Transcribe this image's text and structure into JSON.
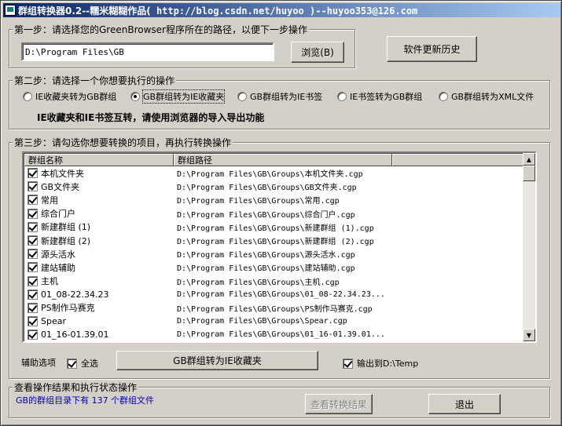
{
  "window": {
    "title_prefix": "群组转换器0.2--糯米糊糊作品(",
    "title_url": " http://blog.csdn.net/huyoo ",
    "title_suffix": ")--huyoo353@126.com"
  },
  "step1": {
    "legend": "第一步：请选择您的GreenBrowser程序所在的路径，以便下一步操作",
    "path_value": "D:\\Program Files\\GB",
    "browse_label": "浏览(B)",
    "history_label": "软件更新历史"
  },
  "step2": {
    "legend": "第二步：请选择一个你想要执行的操作",
    "options": [
      {
        "label": "IE收藏夹转为GB群组",
        "selected": false
      },
      {
        "label": "GB群组转为IE收藏夹",
        "selected": true
      },
      {
        "label": "GB群组转为IE书签",
        "selected": false
      },
      {
        "label": "IE书签转为GB群组",
        "selected": false
      },
      {
        "label": "GB群组转为XML文件",
        "selected": false
      }
    ],
    "note": "IE收藏夹和IE书签互转，请使用浏览器的导入导出功能"
  },
  "step3": {
    "legend": "第三步：请勾选你想要转换的项目，再执行转换操作",
    "columns": [
      "群组名称",
      "群组路径"
    ],
    "rows": [
      {
        "name": "本机文件夹",
        "path": "D:\\Program Files\\GB\\Groups\\本机文件夹.cgp",
        "checked": true
      },
      {
        "name": "GB文件夹",
        "path": "D:\\Program Files\\GB\\Groups\\GB文件夹.cgp",
        "checked": true
      },
      {
        "name": "常用",
        "path": "D:\\Program Files\\GB\\Groups\\常用.cgp",
        "checked": true
      },
      {
        "name": "综合门户",
        "path": "D:\\Program Files\\GB\\Groups\\综合门户.cgp",
        "checked": true
      },
      {
        "name": "新建群组 (1)",
        "path": "D:\\Program Files\\GB\\Groups\\新建群组 (1).cgp",
        "checked": true
      },
      {
        "name": "新建群组 (2)",
        "path": "D:\\Program Files\\GB\\Groups\\新建群组 (2).cgp",
        "checked": true
      },
      {
        "name": "源头活水",
        "path": "D:\\Program Files\\GB\\Groups\\源头活水.cgp",
        "checked": true
      },
      {
        "name": "建站辅助",
        "path": "D:\\Program Files\\GB\\Groups\\建站辅助.cgp",
        "checked": true
      },
      {
        "name": "主机",
        "path": "D:\\Program Files\\GB\\Groups\\主机.cgp",
        "checked": true
      },
      {
        "name": "01_08-22.34.23",
        "path": "D:\\Program Files\\GB\\Groups\\01_08-22.34.23...",
        "checked": true
      },
      {
        "name": "PS制作马赛克",
        "path": "D:\\Program Files\\GB\\Groups\\PS制作马赛克.cgp",
        "checked": true
      },
      {
        "name": "Spear",
        "path": "D:\\Program Files\\GB\\Groups\\Spear.cgp",
        "checked": true
      },
      {
        "name": "01_16-01.39.01",
        "path": "D:\\Program Files\\GB\\Groups\\01_16-01.39.01...",
        "checked": true
      }
    ],
    "aux_label": "辅助选项",
    "select_all_label": "全选",
    "select_all_checked": true,
    "convert_label": "GB群组转为IE收藏夹",
    "output_label": "输出到D:\\Temp",
    "output_checked": true
  },
  "status": {
    "legend": "查看操作结果和执行状态操作",
    "message": "GB的群组目录下有 137 个群组文件",
    "view_result_label": "查看转换结果",
    "exit_label": "退出"
  },
  "colors": {
    "face": "#d4d0c8",
    "title_start": "#0a246a",
    "title_end": "#a6caf0",
    "status_text": "#0000c0"
  }
}
